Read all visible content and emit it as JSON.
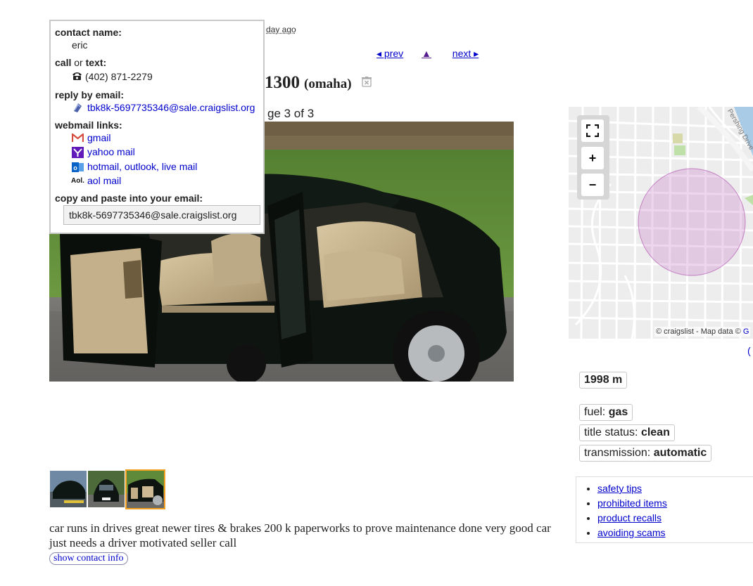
{
  "posting": {
    "posted_ago": "day ago",
    "nav": {
      "prev": "◂ prev",
      "up": "▲",
      "next": "next ▸"
    },
    "title_price": "1300",
    "title_location": "(omaha)",
    "image_counter": "ge 3 of 3",
    "body_text": "car runs in drives great newer tires & brakes 200 k paperworks to prove maintenance done very good car just needs a driver motivated seller call",
    "show_contact_label": "show contact info"
  },
  "reply_popup": {
    "contact_name_label": "contact name:",
    "contact_name": "eric",
    "call_label": "call",
    "call_or": "or",
    "text_label": "text:",
    "phone": "(402) 871-2279",
    "reply_email_label": "reply by email:",
    "reply_email": "tbk8k-5697735346@sale.craigslist.org",
    "webmail_label": "webmail links:",
    "webmail": [
      "gmail",
      "yahoo mail",
      "hotmail, outlook, live mail",
      "aol mail"
    ],
    "aol_badge": "Aol.",
    "copy_label": "copy and paste into your email:",
    "copy_value": "tbk8k-5697735346@sale.craigslist.org"
  },
  "map": {
    "zoom_in": "+",
    "zoom_out": "−",
    "attribution": "© craigslist - Map data ©",
    "attribution_link": "G",
    "street_label": "Pershing Drive",
    "paren_link": "("
  },
  "attributes": {
    "year_make": "1998 m",
    "fuel_label": "fuel:",
    "fuel_value": "gas",
    "title_status_label": "title status:",
    "title_status_value": "clean",
    "transmission_label": "transmission:",
    "transmission_value": "automatic"
  },
  "safety_links": [
    "safety tips",
    "prohibited items",
    "product recalls",
    "avoiding scams"
  ],
  "colors": {
    "link": "#0000cc",
    "visited": "#551a8b",
    "thumb_selected_border": "#f3a020",
    "map_circle": "#c879c8"
  }
}
